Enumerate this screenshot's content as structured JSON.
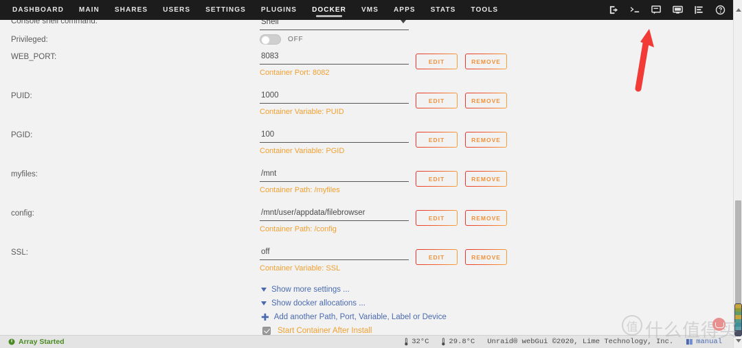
{
  "nav": {
    "items": [
      {
        "label": "DASHBOARD",
        "active": false
      },
      {
        "label": "MAIN",
        "active": false
      },
      {
        "label": "SHARES",
        "active": false
      },
      {
        "label": "USERS",
        "active": false
      },
      {
        "label": "SETTINGS",
        "active": false
      },
      {
        "label": "PLUGINS",
        "active": false
      },
      {
        "label": "DOCKER",
        "active": true
      },
      {
        "label": "VMS",
        "active": false
      },
      {
        "label": "APPS",
        "active": false
      },
      {
        "label": "STATS",
        "active": false
      },
      {
        "label": "TOOLS",
        "active": false
      }
    ],
    "icons": [
      {
        "name": "logout-icon"
      },
      {
        "name": "terminal-icon"
      },
      {
        "name": "feedback-icon"
      },
      {
        "name": "display-icon"
      },
      {
        "name": "log-icon"
      },
      {
        "name": "help-icon"
      }
    ]
  },
  "form": {
    "console_shell": {
      "label": "Console shell command:",
      "value": "Shell"
    },
    "privileged": {
      "label": "Privileged:",
      "state": "OFF"
    },
    "rows": [
      {
        "label": "WEB_PORT:",
        "value": "8083",
        "hint": "Container Port: 8082",
        "edit": "EDIT",
        "remove": "REMOVE"
      },
      {
        "label": "PUID:",
        "value": "1000",
        "hint": "Container Variable: PUID",
        "edit": "EDIT",
        "remove": "REMOVE"
      },
      {
        "label": "PGID:",
        "value": "100",
        "hint": "Container Variable: PGID",
        "edit": "EDIT",
        "remove": "REMOVE"
      },
      {
        "label": "myfiles:",
        "value": "/mnt",
        "hint": "Container Path: /myfiles",
        "edit": "EDIT",
        "remove": "REMOVE"
      },
      {
        "label": "config:",
        "value": "/mnt/user/appdata/filebrowser",
        "hint": "Container Path: /config",
        "edit": "EDIT",
        "remove": "REMOVE"
      },
      {
        "label": "SSL:",
        "value": "off",
        "hint": "Container Variable: SSL",
        "edit": "EDIT",
        "remove": "REMOVE"
      }
    ],
    "links": [
      {
        "icon": "chevron-down-icon",
        "label": "Show more settings ..."
      },
      {
        "icon": "chevron-down-icon",
        "label": "Show docker allocations ..."
      },
      {
        "icon": "plus-icon",
        "label": "Add another Path, Port, Variable, Label or Device"
      }
    ],
    "start_container": {
      "label": "Start Container After Install",
      "checked": true
    }
  },
  "statusbar": {
    "array_status": "Array Started",
    "temps": [
      "32°C",
      "29.8°C"
    ],
    "copyright": "Unraid® webGui ©2020, Lime Technology, Inc.",
    "manual": "manual"
  },
  "watermark": {
    "badge": "值",
    "text": "什么值得买"
  },
  "colors": {
    "nav_bg": "#1c1c1c",
    "page_bg": "#f2f2f2",
    "accent_orange": "#f0a030",
    "accent_red": "#e8322e",
    "link_blue": "#4a6ab0",
    "status_green": "#4a8a22",
    "arrow_red": "#f23b36"
  }
}
